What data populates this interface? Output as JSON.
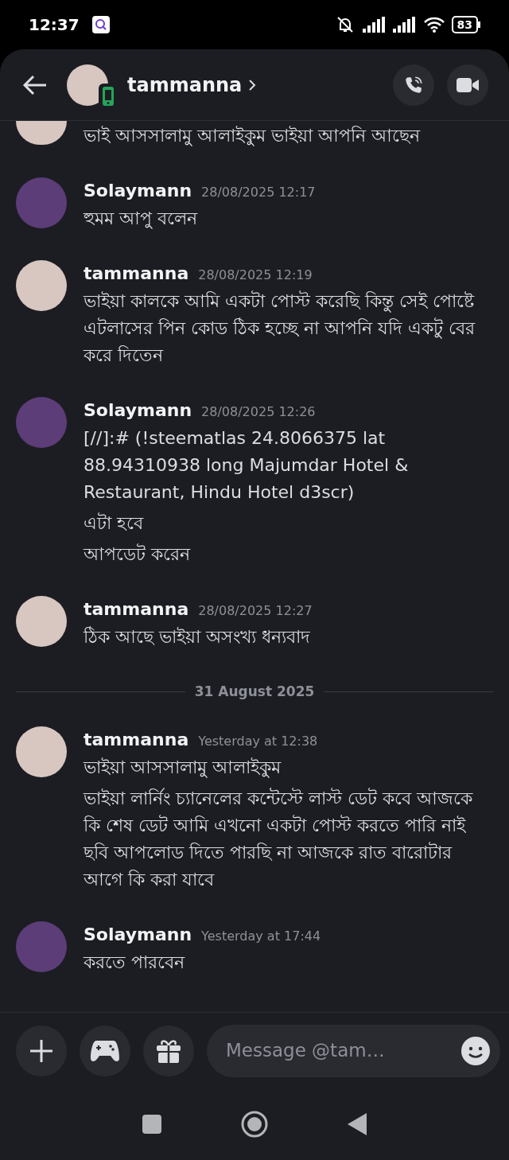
{
  "status_bar": {
    "time": "12:37",
    "battery": "83"
  },
  "header": {
    "name": "tammanna"
  },
  "messages": [
    {
      "kind": "continued",
      "color": "#d8c6c0",
      "paragraphs": [
        "ভাই আসসালামু আলাইকুম ভাইয়া আপনি আছেন"
      ]
    },
    {
      "kind": "message",
      "author": "Solaymann",
      "timestamp": "28/08/2025 12:17",
      "color": "#5c3d78",
      "paragraphs": [
        "হুমম আপু বলেন"
      ]
    },
    {
      "kind": "message",
      "author": "tammanna",
      "timestamp": "28/08/2025 12:19",
      "color": "#d8c6c0",
      "paragraphs": [
        "ভাইয়া কালকে আমি একটা পোস্ট করেছি কিন্তু সেই পোষ্টে এটলাসের  পিন কোড ঠিক হচ্ছে না আপনি যদি একটু বের করে দিতেন"
      ]
    },
    {
      "kind": "message",
      "author": "Solaymann",
      "timestamp": "28/08/2025 12:26",
      "color": "#5c3d78",
      "paragraphs": [
        "[//]:# (!steematlas 24.8066375 lat 88.94310938 long Majumdar Hotel & Restaurant, Hindu Hotel d3scr)",
        "এটা হবে",
        "আপডেট করেন"
      ]
    },
    {
      "kind": "message",
      "author": "tammanna",
      "timestamp": "28/08/2025 12:27",
      "color": "#d8c6c0",
      "paragraphs": [
        "ঠিক আছে ভাইয়া অসংখ্য ধন্যবাদ"
      ]
    },
    {
      "kind": "divider",
      "label": "31 August 2025"
    },
    {
      "kind": "message",
      "author": "tammanna",
      "timestamp": "Yesterday at 12:38",
      "color": "#d8c6c0",
      "paragraphs": [
        "ভাইয়া আসসালামু আলাইকুম",
        "ভাইয়া লার্নিং চ্যানেলের কন্টেস্টে লাস্ট ডেট কবে আজকে কি শেষ ডেট আমি এখনো একটা পোস্ট করতে পারি নাই ছবি আপলোড দিতে পারছি না আজকে রাত বারোটার আগে কি করা যাবে"
      ]
    },
    {
      "kind": "message",
      "author": "Solaymann",
      "timestamp": "Yesterday at 17:44",
      "color": "#5c3d78",
      "paragraphs": [
        "করতে পারবেন"
      ]
    }
  ],
  "composer": {
    "placeholder": "Message @tam…"
  }
}
